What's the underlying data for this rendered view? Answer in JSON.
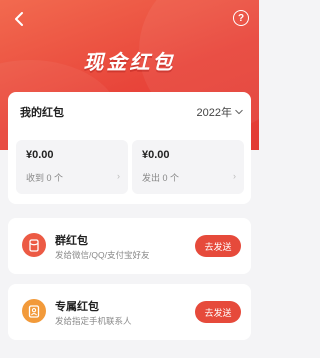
{
  "header": {
    "title": "现金红包",
    "back_icon": "back-arrow-icon",
    "help_glyph": "?"
  },
  "my_packets": {
    "title": "我的红包",
    "year": "2022年",
    "received": {
      "amount": "¥0.00",
      "count_text": "收到 0 个"
    },
    "sent": {
      "amount": "¥0.00",
      "count_text": "发出 0 个"
    }
  },
  "options": [
    {
      "title": "群红包",
      "subtitle": "发给微信/QQ/支付宝好友",
      "button": "去发送",
      "icon": "group-packet-icon",
      "icon_color": "#ec5a44"
    },
    {
      "title": "专属红包",
      "subtitle": "发给指定手机联系人",
      "button": "去发送",
      "icon": "contact-packet-icon",
      "icon_color": "#f29a3a"
    }
  ],
  "colors": {
    "accent": "#e64a3b",
    "hero_start": "#f26a4f",
    "hero_end": "#e23b35"
  }
}
